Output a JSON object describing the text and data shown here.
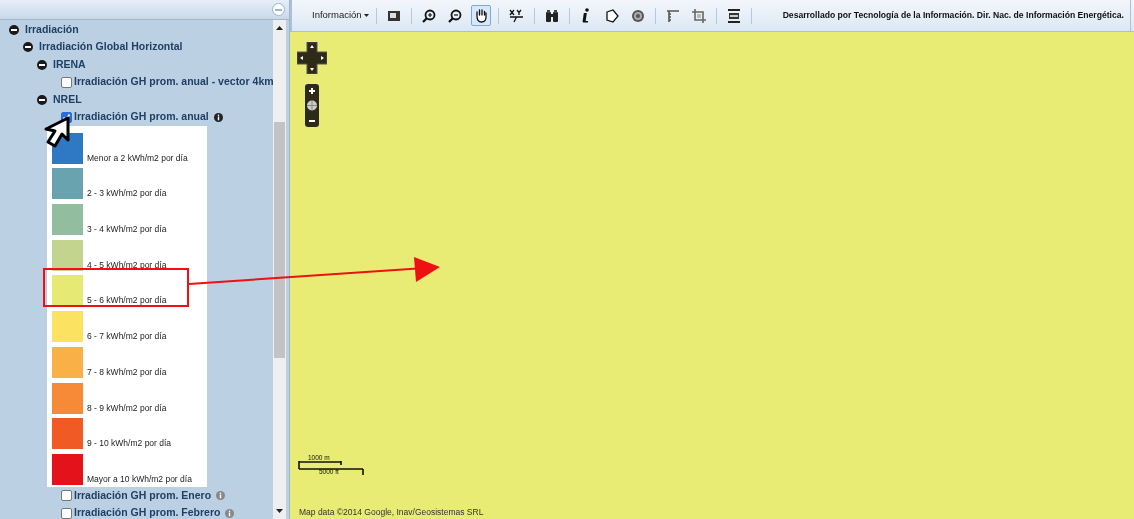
{
  "sidebar": {
    "tree": [
      {
        "label": "Irradiación",
        "expanded": true,
        "children": [
          {
            "label": "Irradiación Global Horizontal",
            "expanded": true,
            "children": [
              {
                "label": "IRENA",
                "expanded": true,
                "children": [
                  {
                    "kind": "layer",
                    "label": "Irradiación GH prom. anual - vector 4km",
                    "checked": false
                  }
                ]
              },
              {
                "label": "NREL",
                "expanded": true,
                "children": [
                  {
                    "kind": "layer",
                    "label": "Irradiación GH prom. anual",
                    "checked": true,
                    "info": true,
                    "legend": [
                      {
                        "label": "Menor a 2 kWh/m2 por día",
                        "color": "#2f78c4",
                        "highlighted": false
                      },
                      {
                        "label": "2 - 3 kWh/m2 por día",
                        "color": "#6aa3b0",
                        "highlighted": false
                      },
                      {
                        "label": "3 - 4 kWh/m2 por día",
                        "color": "#93bd9f",
                        "highlighted": false
                      },
                      {
                        "label": "4 - 5 kWh/m2 por día",
                        "color": "#c2d48d",
                        "highlighted": false
                      },
                      {
                        "label": "5 - 6 kWh/m2 por día",
                        "color": "#e6ea74",
                        "highlighted": true
                      },
                      {
                        "label": "6 - 7 kWh/m2 por día",
                        "color": "#fbe261",
                        "highlighted": false
                      },
                      {
                        "label": "7 - 8 kWh/m2 por día",
                        "color": "#f9b147",
                        "highlighted": false
                      },
                      {
                        "label": "8 - 9 kWh/m2 por día",
                        "color": "#f68a36",
                        "highlighted": false
                      },
                      {
                        "label": "9 - 10 kWh/m2 por día",
                        "color": "#ef5a25",
                        "highlighted": false
                      },
                      {
                        "label": "Mayor a 10 kWh/m2 por día",
                        "color": "#e4121a",
                        "highlighted": false
                      }
                    ]
                  },
                  {
                    "kind": "layer",
                    "label": "Irradiación GH prom. Enero",
                    "checked": false,
                    "info": true
                  },
                  {
                    "kind": "layer",
                    "label": "Irradiación GH prom. Febrero",
                    "checked": false,
                    "info": true
                  }
                ]
              }
            ]
          }
        ]
      }
    ]
  },
  "toolbar": {
    "menu": "Información",
    "tool_groups": [
      [
        {
          "kind": "full-extent",
          "selected": false
        }
      ],
      [
        {
          "kind": "zoom-in",
          "selected": false
        },
        {
          "kind": "zoom-out",
          "selected": false
        },
        {
          "kind": "pan",
          "selected": true
        }
      ],
      [
        {
          "kind": "xy",
          "selected": false
        }
      ],
      [
        {
          "kind": "binoculars",
          "selected": false
        }
      ],
      [
        {
          "kind": "info",
          "selected": false
        },
        {
          "kind": "polygon",
          "selected": false
        },
        {
          "kind": "target",
          "selected": false
        }
      ],
      [
        {
          "kind": "ruler",
          "selected": false
        },
        {
          "kind": "crop",
          "selected": false
        }
      ],
      [
        {
          "kind": "print",
          "selected": false
        }
      ]
    ],
    "credit": "Desarrollado por Tecnología de la Información. Dir. Nac. de Información Energética."
  },
  "map": {
    "scale_metric": "1000 m",
    "scale_imperial": "5000 ft",
    "attribution": "Map data ©2014 Google, Inav/Geosistemas SRL"
  }
}
